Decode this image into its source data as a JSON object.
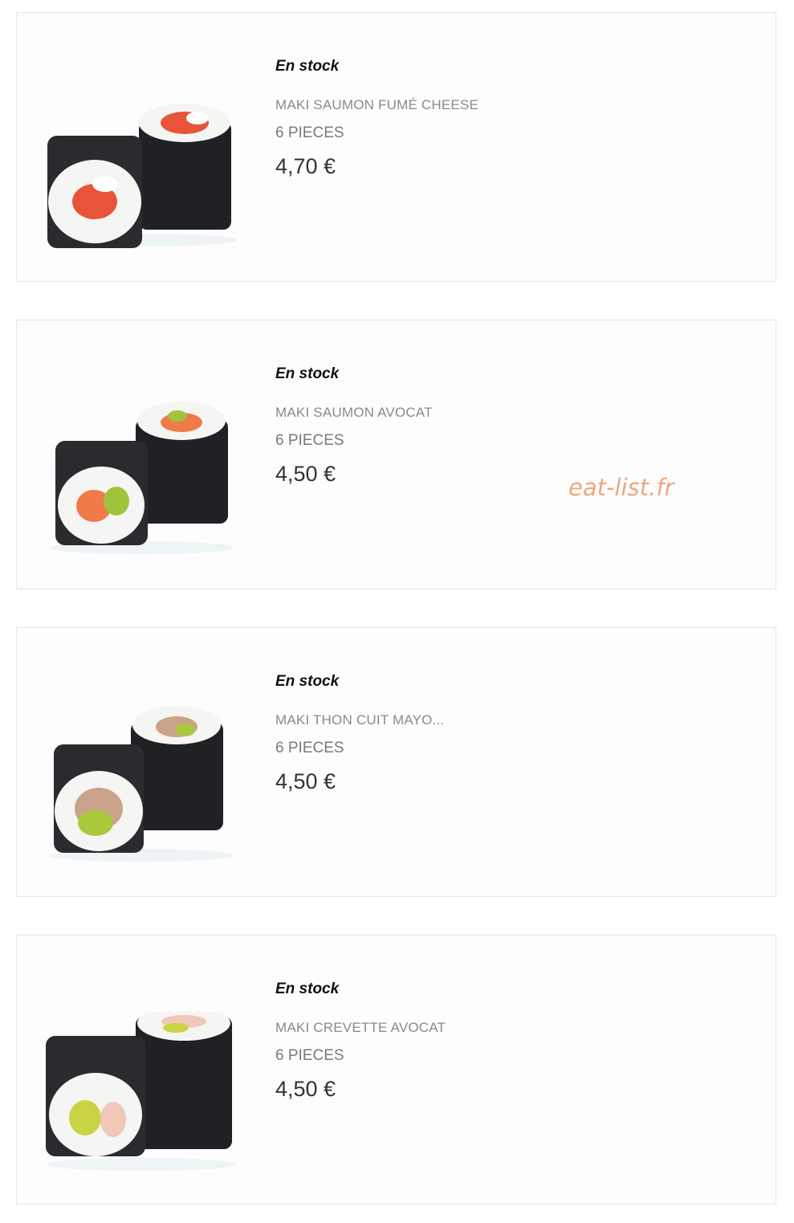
{
  "watermark": "eat-list.fr",
  "products": [
    {
      "stock": "En stock",
      "name": "MAKI SAUMON FUMÉ CHEESE",
      "pieces": "6 PIECES",
      "price": "4,70 €",
      "filling_color": "#e8543a",
      "accent_color": "#ffffff"
    },
    {
      "stock": "En stock",
      "name": "MAKI SAUMON AVOCAT",
      "pieces": "6 PIECES",
      "price": "4,50 €",
      "filling_color": "#f07a4a",
      "accent_color": "#9fc43a"
    },
    {
      "stock": "En stock",
      "name": "MAKI THON CUIT MAYO...",
      "pieces": "6 PIECES",
      "price": "4,50 €",
      "filling_color": "#c9a38a",
      "accent_color": "#a9c93c"
    },
    {
      "stock": "En stock",
      "name": "MAKI CREVETTE AVOCAT",
      "pieces": "6 PIECES",
      "price": "4,50 €",
      "filling_color": "#f0c7b8",
      "accent_color": "#c9d444"
    }
  ]
}
